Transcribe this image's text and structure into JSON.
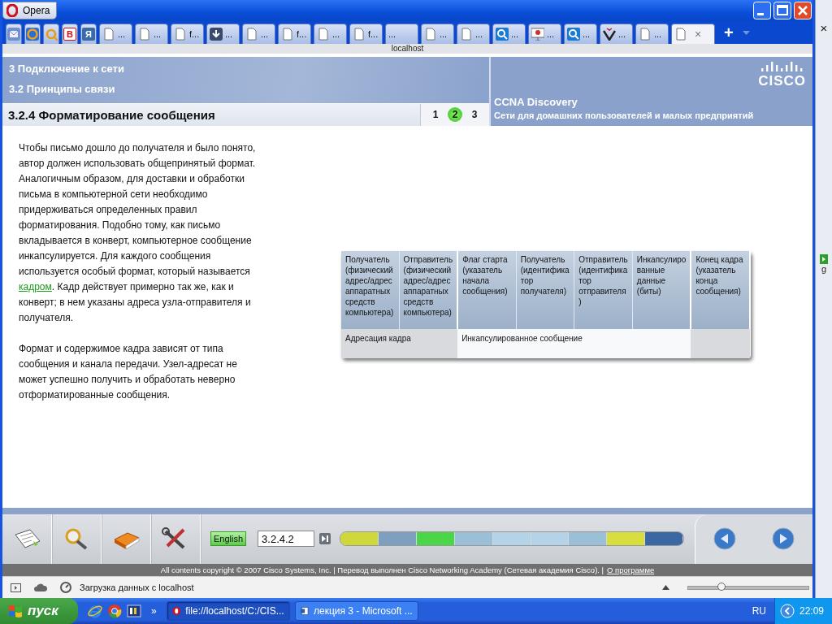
{
  "browser": {
    "menu_button": "Opera",
    "address": "localhost",
    "tabs": [
      {
        "kind": "mail",
        "selected": false
      },
      {
        "kind": "ring",
        "selected": false
      },
      {
        "kind": "sun",
        "selected": false
      },
      {
        "kind": "glyph",
        "glyph": "В",
        "selected": false
      },
      {
        "kind": "glyph",
        "glyph": "Я",
        "selected": false
      },
      {
        "kind": "page",
        "label": "...",
        "selected": false
      },
      {
        "kind": "page",
        "label": "...",
        "selected": false
      },
      {
        "kind": "page",
        "label": "f...",
        "selected": false
      },
      {
        "kind": "download",
        "label": "...",
        "selected": false
      },
      {
        "kind": "page",
        "label": "...",
        "selected": false
      },
      {
        "kind": "page",
        "label": "f...",
        "selected": false
      },
      {
        "kind": "page",
        "label": "...",
        "selected": false
      },
      {
        "kind": "page",
        "label": "f...",
        "selected": false
      },
      {
        "kind": "blank",
        "label": "...",
        "selected": false
      },
      {
        "kind": "page",
        "label": "...",
        "selected": false
      },
      {
        "kind": "page",
        "label": "...",
        "selected": false
      },
      {
        "kind": "search",
        "label": "...",
        "selected": false
      },
      {
        "kind": "slides",
        "label": "...",
        "selected": false
      },
      {
        "kind": "search",
        "label": "...",
        "selected": false
      },
      {
        "kind": "vmark",
        "label": "...",
        "selected": false
      },
      {
        "kind": "page",
        "label": "...",
        "selected": false
      },
      {
        "kind": "page",
        "close": "×",
        "selected": true
      }
    ],
    "new_tab": "+",
    "side_strip": {
      "close": "×",
      "letter": "g"
    }
  },
  "course": {
    "chapter": "3 Подключение к сети",
    "section": "3.2 Принципы связи",
    "topic": "3.2.4 Форматирование сообщения",
    "pages": [
      {
        "label": "1",
        "selected": false
      },
      {
        "label": "2",
        "selected": true
      },
      {
        "label": "3",
        "selected": false
      }
    ],
    "logo": "CISCO",
    "product": "CCNA Discovery",
    "subtitle": "Сети для домашних пользователей и малых предприятий"
  },
  "body": {
    "paragraphs": [
      [
        {
          "kind": "text",
          "text": "Чтобы письмо дошло до получателя и было понято, автор должен использовать общепринятый формат. Аналогичным образом, для доставки и обработки письма в компьютерной сети необходимо придерживаться определенных правил форматирования. Подобно тому, как письмо вкладывается в конверт, компьютерное сообщение инкапсулируется. Для каждого сообщения используется особый формат, который называется "
        },
        {
          "kind": "link",
          "text": "кадром"
        },
        {
          "kind": "text",
          "text": ". Кадр действует примерно так же, как и конверт; в нем указаны адреса узла-отправителя и получателя."
        }
      ],
      [
        {
          "kind": "text",
          "text": "Формат и содержимое кадра зависят от типа сообщения и канала передачи. Узел-адресат не может успешно получить и обработать неверно отформатированные сообщения."
        }
      ]
    ]
  },
  "table": {
    "groups": [
      {
        "kind": "addressing",
        "label": "Адресация кадра",
        "columns": [
          "Получатель (физический адрес/адрес аппаратных средств компьютера)",
          "Отправитель (физический адрес/адрес аппаратных средств компьютера)"
        ]
      },
      {
        "kind": "payload",
        "label": "Инкапсулированное сообщение",
        "columns": [
          "Флаг старта (указатель начала сообщения)",
          "Получатель (идентифика тор получателя)",
          "Отправитель (идентифика тор отправителя )",
          "Инкапсулиро ванные данные (биты)"
        ]
      },
      {
        "kind": "trailer",
        "columns": [
          "Конец кадра (указатель конца сообщения)"
        ]
      }
    ]
  },
  "toolbar": {
    "language": "English",
    "page_field": "3.2.4.2",
    "progress": [
      {
        "color": "#cfd83a"
      },
      {
        "color": "#7f9fc0"
      },
      {
        "color": "#4ad646"
      },
      {
        "color": "#9cbfd8"
      },
      {
        "color": "#b5d3e6"
      },
      {
        "color": "#b5d3e6"
      },
      {
        "color": "#9cbfd8"
      },
      {
        "color": "#d8de3e"
      },
      {
        "color": "#3b67a2"
      }
    ]
  },
  "copyright": {
    "text": "All contents copyright © 2007 Cisco Systems, Inc. | Перевод выполнен Cisco Networking Academy (Сетевая академия Cisco). |",
    "link": "О программе"
  },
  "status_bar": {
    "text": "Загрузка данных с localhost",
    "zoom": {
      "level": 0.28
    }
  },
  "taskbar": {
    "start": "пуск",
    "more": "»",
    "tasks": [
      {
        "label": "file://localhost/C:/CIS...",
        "kind": "opera",
        "selected": true
      },
      {
        "label": "лекция 3 - Microsoft ...",
        "kind": "word",
        "selected": false
      }
    ],
    "language": "RU",
    "clock": "22:09"
  }
}
